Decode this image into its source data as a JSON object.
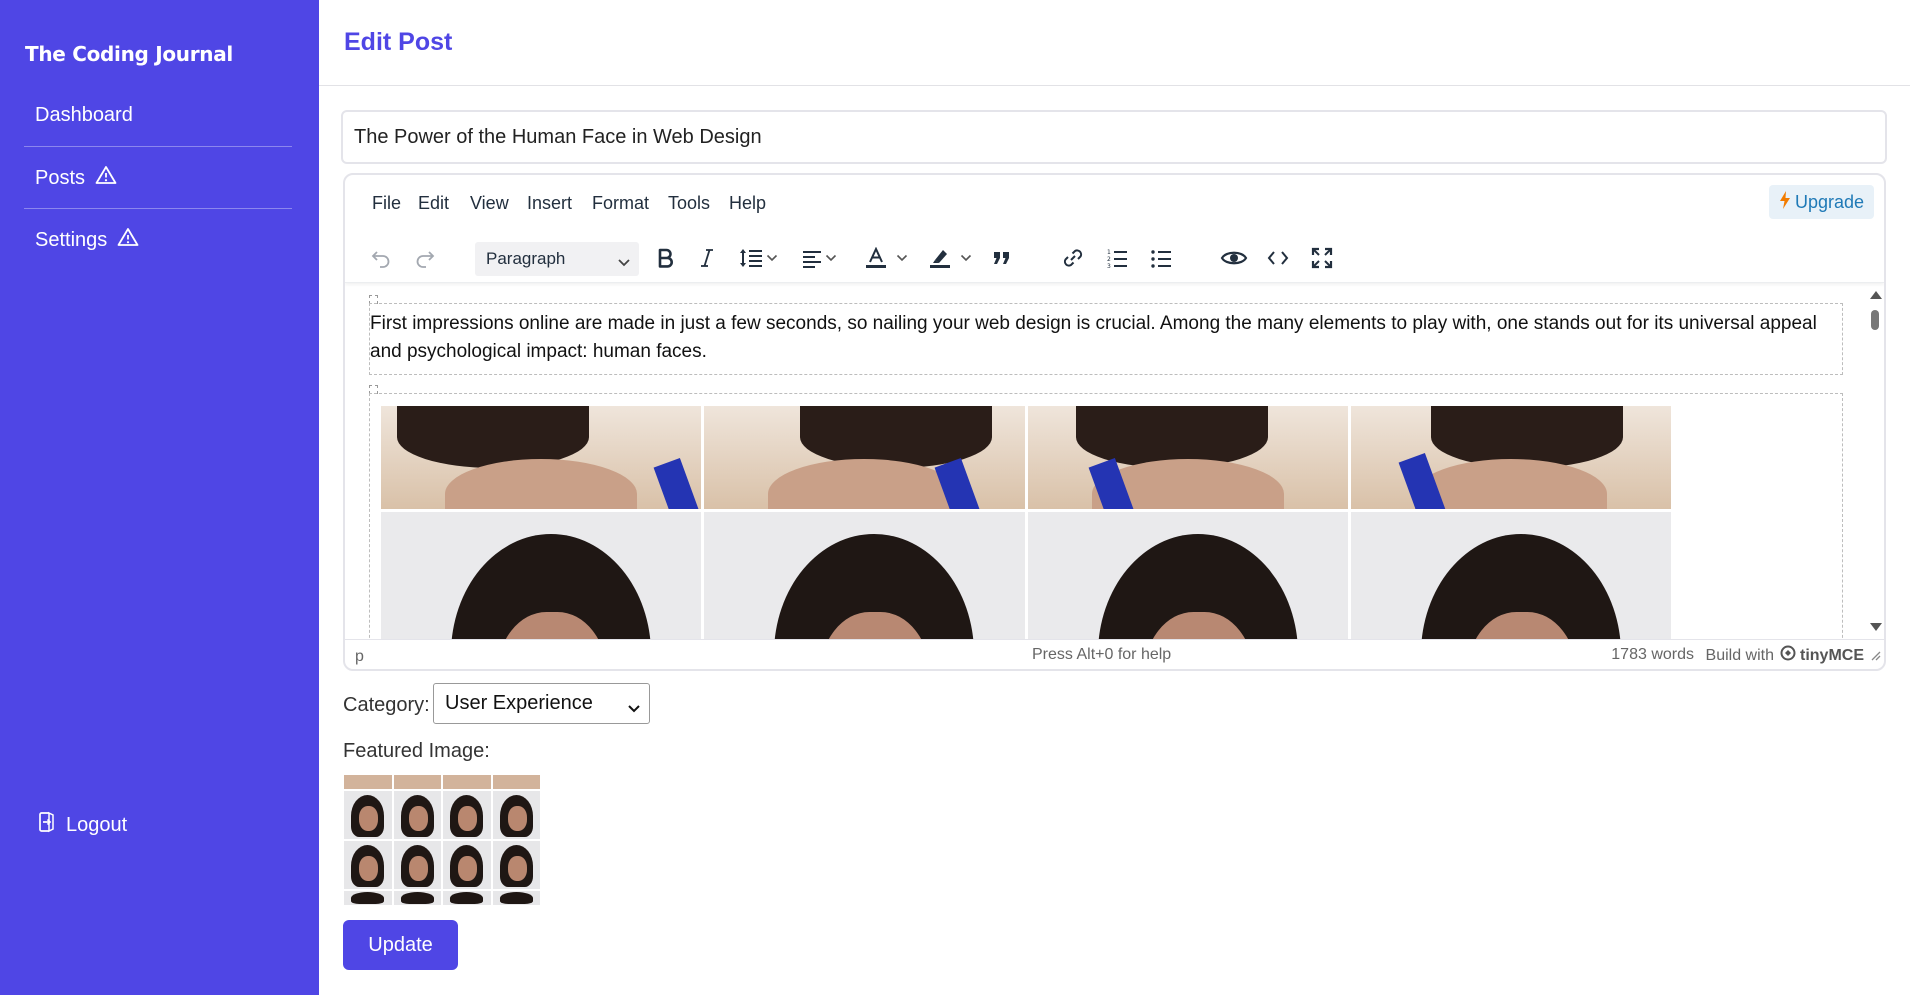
{
  "app": {
    "brand": "The Coding Journal"
  },
  "sidebar": {
    "items": [
      {
        "label": "Dashboard",
        "icon": ""
      },
      {
        "label": "Posts",
        "icon": "warning-icon"
      },
      {
        "label": "Settings",
        "icon": "warning-icon"
      }
    ],
    "logout": {
      "label": "Logout",
      "icon": "logout-icon"
    }
  },
  "header": {
    "title": "Edit Post"
  },
  "form": {
    "title_value": "The Power of the Human Face in Web Design",
    "category_label": "Category:",
    "category_value": "User Experience",
    "featured_label": "Featured Image:",
    "update_label": "Update"
  },
  "editor": {
    "menu": [
      "File",
      "Edit",
      "View",
      "Insert",
      "Format",
      "Tools",
      "Help"
    ],
    "upgrade_label": "Upgrade",
    "block_format": "Paragraph",
    "toolbar_icons": [
      "undo-icon",
      "redo-icon",
      "bold-icon",
      "italic-icon",
      "line-height-icon",
      "align-icon",
      "text-color-icon",
      "highlight-icon",
      "blockquote-icon",
      "link-icon",
      "numbered-list-icon",
      "bullet-list-icon",
      "preview-icon",
      "source-code-icon",
      "fullscreen-icon"
    ],
    "content_paragraph": "First impressions online are made in just a few seconds, so nailing your web design is crucial. Among the many elements to play with, one stands out for its universal appeal and psychological impact: human faces.",
    "status": {
      "path": "p",
      "help": "Press Alt+0 for help",
      "words": "1783 words",
      "build_with": "Build with",
      "brand": "tinyMCE"
    }
  },
  "colors": {
    "accent": "#4f46e5",
    "upgrade_bg": "#e8f1f8",
    "upgrade_text": "#207ab7"
  }
}
